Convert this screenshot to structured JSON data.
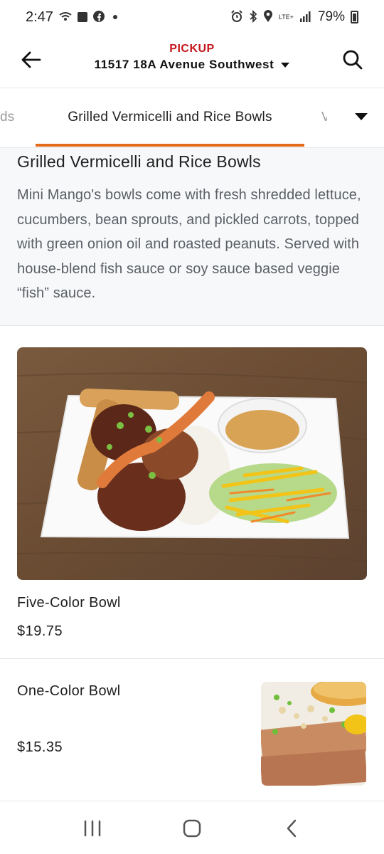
{
  "status_bar": {
    "time": "2:47",
    "battery": "79%",
    "network": "LTE+",
    "icons": [
      "wifi-calling-icon",
      "notification-icon",
      "facebook-icon",
      "dot-icon",
      "alarm-icon",
      "bluetooth-icon",
      "location-icon",
      "signal-icon",
      "battery-icon"
    ]
  },
  "header": {
    "mode": "PICKUP",
    "address": "11517 18A Avenue Southwest",
    "back_icon": "arrow-left-icon",
    "search_icon": "search-icon",
    "dropdown_icon": "chevron-down-icon"
  },
  "tabs": {
    "prev_partial": "ds",
    "active": "Grilled Vermicelli and Rice Bowls",
    "next_partial": "V",
    "accent": "#e36a1a"
  },
  "category": {
    "title": "Grilled Vermicelli and Rice Bowls",
    "description": "Mini Mango's bowls come with fresh shredded lettuce, cucumbers, bean sprouts, and pickled carrots, topped with green onion oil and roasted peanuts. Served with house-blend fish sauce or soy sauce based veggie “fish” sauce."
  },
  "items": [
    {
      "name": "Five-Color Bowl",
      "price": "$19.75"
    },
    {
      "name": "One-Color Bowl",
      "price": "$15.35"
    }
  ],
  "nav": {
    "icons": [
      "recent-apps-icon",
      "home-icon",
      "back-icon"
    ]
  },
  "colors": {
    "pickup": "#c4161c",
    "tab_underline": "#e36a1a"
  }
}
